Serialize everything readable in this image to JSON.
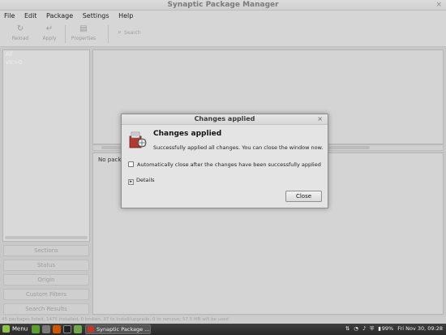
{
  "window": {
    "title": "Synaptic Package Manager",
    "close_glyph": "×"
  },
  "menubar": [
    "File",
    "Edit",
    "Package",
    "Settings",
    "Help"
  ],
  "toolbar": {
    "reload": "Reload",
    "apply": "Apply",
    "properties": "Properties",
    "search": "Search"
  },
  "filter_list": {
    "items": [
      "All",
      "vlc>0"
    ]
  },
  "sidebar_buttons": [
    "Sections",
    "Status",
    "Origin",
    "Custom Filters",
    "Search Results"
  ],
  "details_pane": {
    "text": "No package is selected."
  },
  "statusbar": {
    "text": "45 packages listed, 1475 installed, 0 broken. 37 to install/upgrade, 0 to remove; 57.5 MB will be used"
  },
  "dialog": {
    "title": "Changes applied",
    "close_glyph": "×",
    "heading": "Changes applied",
    "message": "Successfully applied all changes. You can close the window now.",
    "auto_close_label": "Automatically close after the changes have been successfully applied",
    "auto_close_checked": false,
    "details_label": "Details",
    "details_arrow": "▸",
    "close_button": "Close"
  },
  "taskbar": {
    "menu_label": "Menu",
    "task_label": "Synaptic Package ...",
    "battery": "99%",
    "clock": "Fri Nov 30, 09:28"
  },
  "colors": {
    "menu_icon": "#8bc34a",
    "synaptic_icon": "#c0392b"
  }
}
